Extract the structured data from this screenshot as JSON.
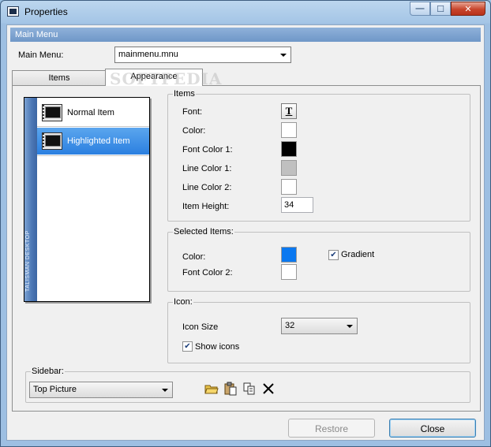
{
  "window": {
    "title": "Properties"
  },
  "section": {
    "title": "Main Menu"
  },
  "main_menu": {
    "label": "Main Menu:",
    "value": "mainmenu.mnu"
  },
  "tabs": [
    {
      "label": "Items",
      "active": false
    },
    {
      "label": "Appearance",
      "active": true
    }
  ],
  "watermark": "SOFTPEDIA",
  "preview": {
    "sidebar_text": "TALISMAN DESKTOP",
    "items": [
      {
        "label": "Normal Item"
      },
      {
        "label": "Highlighted Item"
      }
    ]
  },
  "items_group": {
    "title": "Items",
    "font_label": "Font:",
    "font_button": "T",
    "color_label": "Color:",
    "font_color1_label": "Font Color 1:",
    "line_color1_label": "Line Color 1:",
    "line_color2_label": "Line Color 2:",
    "item_height_label": "Item Height:",
    "item_height_value": "34",
    "colors": {
      "color": "#ffffff",
      "font_color1": "#000000",
      "line_color1": "#c0c0c0",
      "line_color2": "#ffffff"
    }
  },
  "selected_group": {
    "title": "Selected Items:",
    "color_label": "Color:",
    "font_color2_label": "Font Color 2:",
    "gradient_label": "Gradient",
    "gradient_checked": true,
    "colors": {
      "color": "#0a78f0",
      "font_color2": "#ffffff"
    }
  },
  "icon_group": {
    "title": "Icon:",
    "icon_size_label": "Icon Size",
    "icon_size_value": "32",
    "show_icons_label": "Show icons",
    "show_icons_checked": true
  },
  "sidebar_group": {
    "title": "Sidebar:",
    "value": "Top Picture",
    "tools": [
      "open-folder-icon",
      "paste-icon",
      "copy-icon",
      "delete-icon"
    ]
  },
  "buttons": {
    "restore": "Restore",
    "close": "Close"
  },
  "caption_buttons": {
    "minimize": "—",
    "maximize": "☐",
    "close": "✕"
  }
}
